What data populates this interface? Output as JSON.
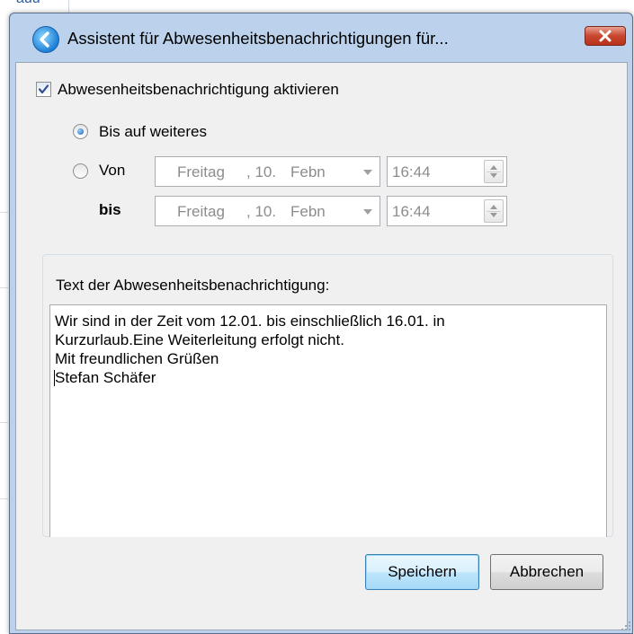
{
  "background": {
    "partial_text": "auu"
  },
  "window": {
    "title": "Assistent für Abwesenheitsbenachrichtigungen für...",
    "enable_label": "Abwesenheitsbenachrichtigung aktivieren",
    "enable_checked": true,
    "radio_until_further": "Bis auf weiteres",
    "radio_from": "Von",
    "selected_radio": "until_further",
    "to_label": "bis",
    "from_date": {
      "weekday": "Freitag",
      "day": ", 10.",
      "month": "Febn"
    },
    "from_time": "16:44",
    "to_date": {
      "weekday": "Freitag",
      "day": ", 10.",
      "month": "Febn"
    },
    "to_time": "16:44",
    "message_label": "Text der Abwesenheitsbenachrichtigung:",
    "message_lines": [
      "Wir sind in der Zeit vom 12.01. bis einschließlich 16.01. in",
      "Kurzurlaub.Eine Weiterleitung erfolgt nicht.",
      "Mit freundlichen Grüßen",
      "Stefan Schäfer"
    ],
    "save_label": "Speichern",
    "cancel_label": "Abbrechen"
  }
}
